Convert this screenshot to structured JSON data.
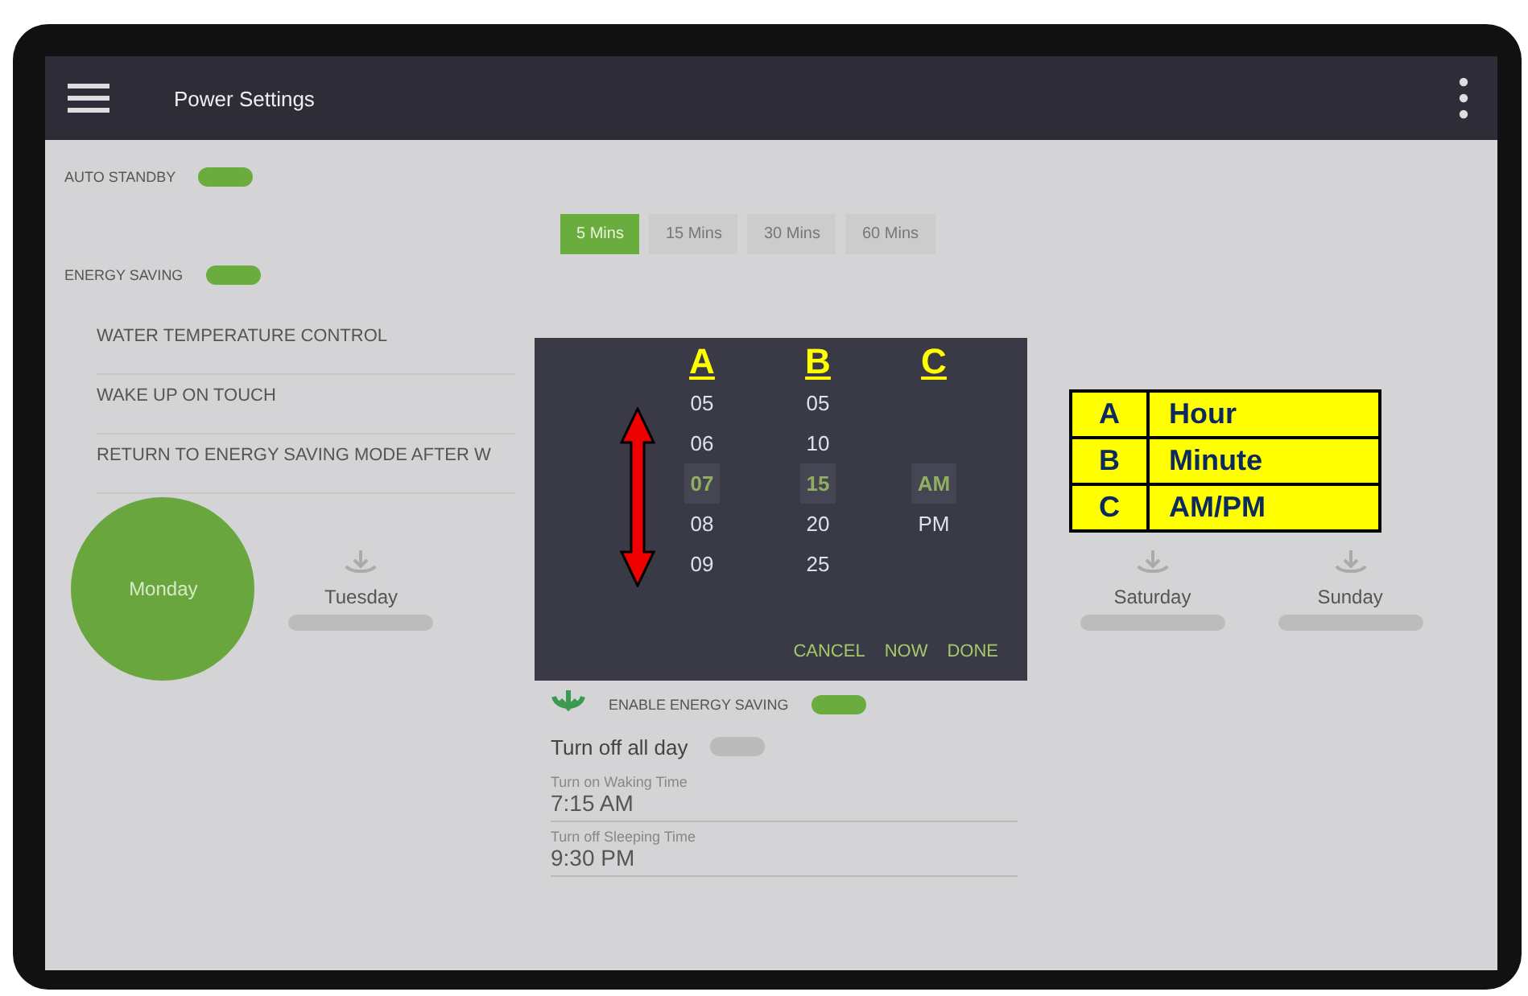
{
  "header": {
    "title": "Power Settings"
  },
  "auto_standby": {
    "label": "AUTO STANDBY",
    "on": true
  },
  "tabs": [
    {
      "label": "5 Mins",
      "selected": true
    },
    {
      "label": "15 Mins",
      "selected": false
    },
    {
      "label": "30 Mins",
      "selected": false
    },
    {
      "label": "60 Mins",
      "selected": false
    }
  ],
  "energy_saving": {
    "label": "ENERGY SAVING",
    "on": true
  },
  "settings": [
    "WATER TEMPERATURE CONTROL",
    "WAKE UP ON TOUCH",
    "RETURN TO ENERGY SAVING MODE AFTER W"
  ],
  "days": [
    {
      "name": "Monday",
      "selected": true
    },
    {
      "name": "Tuesday",
      "selected": false
    },
    {
      "name": "Saturday",
      "selected": false
    },
    {
      "name": "Sunday",
      "selected": false
    }
  ],
  "enable_energy_saving": {
    "label": "ENABLE ENERGY SAVING",
    "on": true
  },
  "turn_off_all_day": {
    "label": "Turn off all day",
    "on": false
  },
  "fields": [
    {
      "label": "Turn on Waking Time",
      "value": "7:15 AM"
    },
    {
      "label": "Turn off Sleeping Time",
      "value": "9:30 PM"
    }
  ],
  "time_picker": {
    "columns": [
      {
        "letter": "A",
        "values": [
          {
            "text": "05",
            "selected": false
          },
          {
            "text": "06",
            "selected": false
          },
          {
            "text": "07",
            "selected": true
          },
          {
            "text": "08",
            "selected": false
          },
          {
            "text": "09",
            "selected": false
          }
        ]
      },
      {
        "letter": "B",
        "values": [
          {
            "text": "05",
            "selected": false
          },
          {
            "text": "10",
            "selected": false
          },
          {
            "text": "15",
            "selected": true
          },
          {
            "text": "20",
            "selected": false
          },
          {
            "text": "25",
            "selected": false
          }
        ]
      },
      {
        "letter": "C",
        "kind": "ampm",
        "values": [
          {
            "text": "AM",
            "selected": true
          },
          {
            "text": "PM",
            "selected": false
          }
        ]
      }
    ],
    "buttons": [
      "CANCEL",
      "NOW",
      "DONE"
    ]
  },
  "legend": [
    {
      "letter": "A",
      "meaning": "Hour"
    },
    {
      "letter": "B",
      "meaning": "Minute"
    },
    {
      "letter": "C",
      "meaning": "AM/PM"
    }
  ]
}
